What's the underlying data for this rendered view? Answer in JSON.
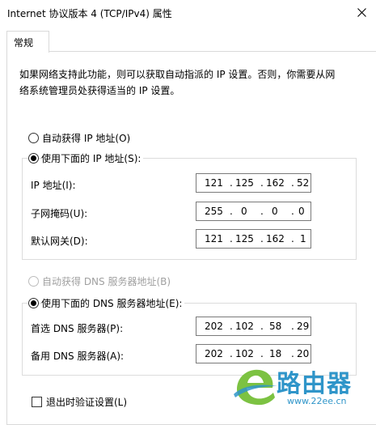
{
  "window": {
    "title": "Internet 协议版本 4 (TCP/IPv4) 属性",
    "close_icon": "close-icon"
  },
  "tabs": [
    {
      "label": "常规",
      "selected": true
    }
  ],
  "intro": {
    "line1": "如果网络支持此功能，则可以获取自动指派的 IP 设置。否则，你需要从网",
    "line2": "络系统管理员处获得适当的 IP 设置。"
  },
  "ip": {
    "auto_label": "自动获得 IP 地址(O)",
    "auto_checked": false,
    "manual_label": "使用下面的 IP 地址(S):",
    "manual_checked": true,
    "fields": [
      {
        "label": "IP 地址(I):",
        "octets": [
          "121",
          "125",
          "162",
          "52"
        ]
      },
      {
        "label": "子网掩码(U):",
        "octets": [
          "255",
          "0",
          "0",
          "0"
        ]
      },
      {
        "label": "默认网关(D):",
        "octets": [
          "121",
          "125",
          "162",
          "1"
        ]
      }
    ]
  },
  "dns": {
    "auto_label": "自动获得 DNS 服务器地址(B)",
    "auto_checked": false,
    "auto_disabled": true,
    "manual_label": "使用下面的 DNS 服务器地址(E):",
    "manual_checked": true,
    "fields": [
      {
        "label": "首选 DNS 服务器(P):",
        "octets": [
          "202",
          "102",
          "58",
          "29"
        ]
      },
      {
        "label": "备用 DNS 服务器(A):",
        "octets": [
          "202",
          "102",
          "18",
          "20"
        ]
      }
    ]
  },
  "validate": {
    "label": "退出时验证设置(L)",
    "checked": false
  },
  "watermark": {
    "brand": "路由器",
    "url": "www.22ee.cn",
    "color": "#2f95c9",
    "accent": "#7cc242"
  }
}
